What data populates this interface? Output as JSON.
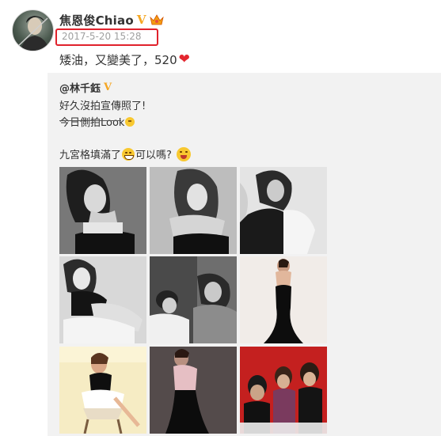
{
  "post": {
    "author_name": "焦恩俊Chiao",
    "verified_mark": "V",
    "timestamp": "2017-5-20 15:28",
    "text": "矮油，又變美了，520"
  },
  "repost": {
    "author": "@林千鈺",
    "verified_mark": "V",
    "line1": "好久沒拍宣傳照了!",
    "line2": "今日側拍Look",
    "line3_pre": "九宮格填滿了",
    "line3_post": "可以嗎?"
  },
  "colors": {
    "highlight_box": "#e0222c",
    "verified": "#f5a623",
    "heart": "#e3262f",
    "repost_bg": "#f2f2f2"
  },
  "photos": [
    "photo-1",
    "photo-2",
    "photo-3",
    "photo-4",
    "photo-5",
    "photo-6",
    "photo-7",
    "photo-8",
    "photo-9"
  ]
}
